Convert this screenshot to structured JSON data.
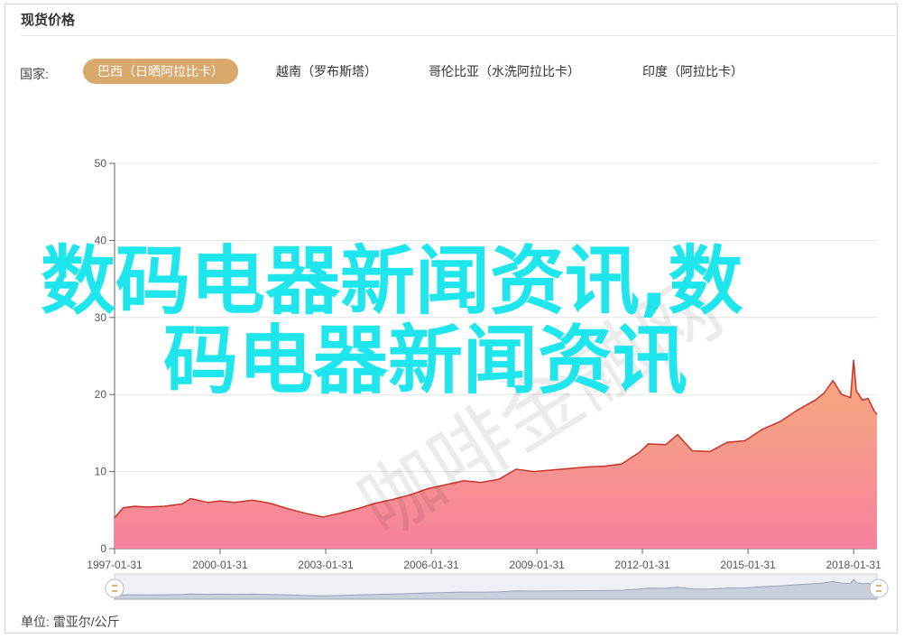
{
  "panel": {
    "title": "现货价格"
  },
  "country_filter": {
    "label": "国家:",
    "tabs": [
      {
        "label": "巴西（日晒阿拉比卡）",
        "active": true
      },
      {
        "label": "越南（罗布斯塔）",
        "active": false
      },
      {
        "label": "哥伦比亚（水洗阿拉比卡）",
        "active": false
      },
      {
        "label": "印度（阿拉比卡）",
        "active": false
      }
    ]
  },
  "unit": "单位: 雷亚尔/公斤",
  "watermark": {
    "line1": "数码电器新闻资讯,数",
    "line2": "码电器新闻资讯"
  },
  "stamp_text": "咖啡金融网",
  "colors": {
    "accent": "#d9a86b",
    "line": "#c8342a",
    "fill_top": "#f5a873",
    "fill_bottom": "#f77a99",
    "watermark": "#1fe6ec"
  },
  "chart_data": {
    "type": "area",
    "title": "",
    "xlabel": "",
    "ylabel": "",
    "ylim": [
      0,
      50
    ],
    "yticks": [
      0,
      10,
      20,
      30,
      40,
      50
    ],
    "xlim": [
      "1997-01-31",
      "2018-09-30"
    ],
    "xticks": [
      "1997-01-31",
      "2000-01-31",
      "2003-01-31",
      "2006-01-31",
      "2009-01-31",
      "2012-01-31",
      "2015-01-31",
      "2018-01-31"
    ],
    "grid": true,
    "series": [
      {
        "points": [
          [
            "1997-01-31",
            4.0
          ],
          [
            "1997-04-30",
            5.3
          ],
          [
            "1997-08-31",
            5.5
          ],
          [
            "1997-12-31",
            5.4
          ],
          [
            "1998-06-30",
            5.5
          ],
          [
            "1998-12-31",
            5.8
          ],
          [
            "1999-03-31",
            6.5
          ],
          [
            "1999-09-30",
            6.0
          ],
          [
            "2000-01-31",
            6.2
          ],
          [
            "2000-06-30",
            6.0
          ],
          [
            "2000-12-31",
            6.3
          ],
          [
            "2001-06-30",
            5.9
          ],
          [
            "2001-12-31",
            5.2
          ],
          [
            "2002-06-30",
            4.6
          ],
          [
            "2002-12-31",
            4.1
          ],
          [
            "2003-06-30",
            4.6
          ],
          [
            "2003-12-31",
            5.2
          ],
          [
            "2004-06-30",
            5.9
          ],
          [
            "2004-12-31",
            6.4
          ],
          [
            "2005-06-30",
            7.0
          ],
          [
            "2005-12-31",
            7.8
          ],
          [
            "2006-06-30",
            8.3
          ],
          [
            "2006-12-31",
            8.8
          ],
          [
            "2007-06-30",
            8.6
          ],
          [
            "2007-12-31",
            9.0
          ],
          [
            "2008-06-30",
            10.3
          ],
          [
            "2008-12-31",
            10.0
          ],
          [
            "2009-06-30",
            10.2
          ],
          [
            "2009-12-31",
            10.4
          ],
          [
            "2010-06-30",
            10.6
          ],
          [
            "2010-12-31",
            10.7
          ],
          [
            "2011-06-30",
            11.0
          ],
          [
            "2011-12-31",
            12.5
          ],
          [
            "2012-03-31",
            13.6
          ],
          [
            "2012-09-30",
            13.5
          ],
          [
            "2013-01-31",
            14.8
          ],
          [
            "2013-06-30",
            12.7
          ],
          [
            "2013-12-31",
            12.6
          ],
          [
            "2014-06-30",
            13.8
          ],
          [
            "2014-12-31",
            14.0
          ],
          [
            "2015-06-30",
            15.5
          ],
          [
            "2015-12-31",
            16.5
          ],
          [
            "2016-06-30",
            18.0
          ],
          [
            "2016-12-31",
            19.3
          ],
          [
            "2017-03-31",
            20.2
          ],
          [
            "2017-06-30",
            21.8
          ],
          [
            "2017-09-30",
            20.0
          ],
          [
            "2017-12-31",
            19.6
          ],
          [
            "2018-01-31",
            24.5
          ],
          [
            "2018-02-28",
            20.5
          ],
          [
            "2018-04-30",
            19.3
          ],
          [
            "2018-06-30",
            19.5
          ],
          [
            "2018-08-31",
            17.9
          ],
          [
            "2018-09-30",
            17.4
          ]
        ]
      }
    ]
  }
}
